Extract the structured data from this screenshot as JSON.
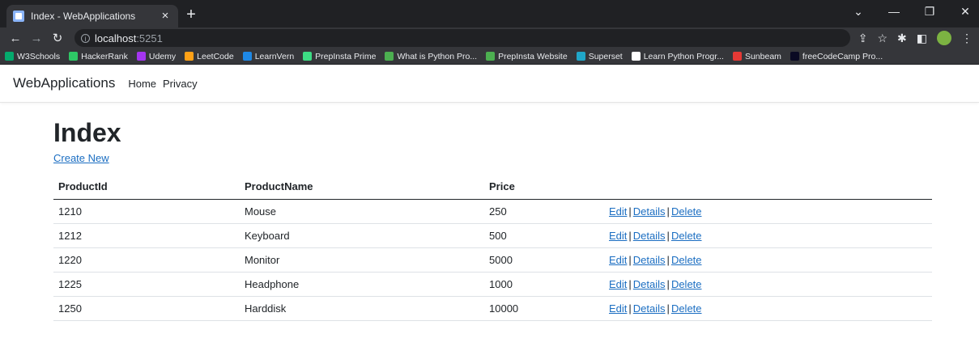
{
  "browser": {
    "tab_title": "Index - WebApplications",
    "url_host": "localhost",
    "url_port": ":5251",
    "bookmarks": [
      {
        "label": "W3Schools",
        "color": "#04aa6d"
      },
      {
        "label": "HackerRank",
        "color": "#2ec866"
      },
      {
        "label": "Udemy",
        "color": "#a435f0"
      },
      {
        "label": "LeetCode",
        "color": "#ffa116"
      },
      {
        "label": "LearnVern",
        "color": "#1e88e5"
      },
      {
        "label": "PrepInsta Prime",
        "color": "#3ddc84"
      },
      {
        "label": "What is Python Pro...",
        "color": "#4caf50"
      },
      {
        "label": "PrepInsta Website",
        "color": "#4caf50"
      },
      {
        "label": "Superset",
        "color": "#20a7c9"
      },
      {
        "label": "Learn Python Progr...",
        "color": "#ffffff"
      },
      {
        "label": "Sunbeam",
        "color": "#e53935"
      },
      {
        "label": "freeCodeCamp Pro...",
        "color": "#0a0a23"
      }
    ]
  },
  "app": {
    "brand": "WebApplications",
    "nav": [
      "Home",
      "Privacy"
    ]
  },
  "page": {
    "title": "Index",
    "create_link": "Create New",
    "columns": [
      "ProductId",
      "ProductName",
      "Price"
    ],
    "rows": [
      {
        "id": "1210",
        "name": "Mouse",
        "price": "250"
      },
      {
        "id": "1212",
        "name": "Keyboard",
        "price": "500"
      },
      {
        "id": "1220",
        "name": "Monitor",
        "price": "5000"
      },
      {
        "id": "1225",
        "name": "Headphone",
        "price": "1000"
      },
      {
        "id": "1250",
        "name": "Harddisk",
        "price": "10000"
      }
    ],
    "actions": {
      "edit": "Edit",
      "details": "Details",
      "delete": "Delete",
      "separator": "|"
    }
  },
  "colors": {
    "link": "#1b6ec2",
    "chrome_dark": "#202124",
    "chrome_mid": "#35363a"
  }
}
